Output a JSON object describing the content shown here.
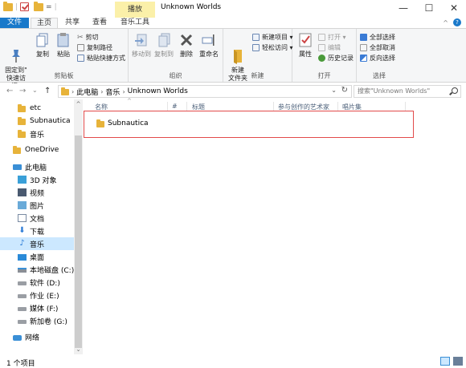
{
  "titlebar": {
    "qat_separator": "|",
    "qat_customize": "=",
    "contextual_tab": "播放",
    "title": "Unknown Worlds",
    "minimize": "—",
    "maximize": "☐",
    "close": "✕"
  },
  "tabs": {
    "file": "文件",
    "home": "主页",
    "share": "共享",
    "view": "查看",
    "music_tools": "音乐工具",
    "collapse": "^",
    "help": "?"
  },
  "ribbon": {
    "clipboard": {
      "pin": "固定到\"\n快速访问\"",
      "copy": "复制",
      "paste": "粘贴",
      "cut": "剪切",
      "copy_path": "复制路径",
      "paste_shortcut": "粘贴快捷方式",
      "label": "剪贴板"
    },
    "organize": {
      "move_to": "移动到",
      "copy_to": "复制到",
      "delete": "删除",
      "rename": "重命名",
      "label": "组织"
    },
    "new": {
      "new_folder": "新建\n文件夹",
      "new_item": "新建项目 ▾",
      "easy_access": "轻松访问 ▾",
      "label": "新建"
    },
    "open": {
      "properties": "属性",
      "open": "打开 ▾",
      "edit": "编辑",
      "history": "历史记录",
      "label": "打开"
    },
    "select": {
      "select_all": "全部选择",
      "select_none": "全部取消",
      "invert": "反向选择",
      "label": "选择"
    }
  },
  "address": {
    "back": "←",
    "forward": "→",
    "recent": "⌄",
    "up": "↑",
    "sep": "›",
    "crumbs": [
      "此电脑",
      "音乐",
      "Unknown Worlds"
    ],
    "dropdown": "⌄",
    "refresh": "↻",
    "search_placeholder": "搜索\"Unknown Worlds\""
  },
  "nav": {
    "items": [
      {
        "label": "etc"
      },
      {
        "label": "Subnautica"
      },
      {
        "label": "音乐"
      },
      {
        "label": "OneDrive"
      },
      {
        "label": "此电脑"
      },
      {
        "label": "3D 对象"
      },
      {
        "label": "视频"
      },
      {
        "label": "图片"
      },
      {
        "label": "文档"
      },
      {
        "label": "下载"
      },
      {
        "label": "音乐"
      },
      {
        "label": "桌面"
      },
      {
        "label": "本地磁盘 (C:)"
      },
      {
        "label": "软件 (D:)"
      },
      {
        "label": "作业 (E:)"
      },
      {
        "label": "媒体 (F:)"
      },
      {
        "label": "新加卷 (G:)"
      },
      {
        "label": "网络"
      }
    ],
    "scroll_up": "^",
    "scroll_down": "⌄"
  },
  "content": {
    "sort_caret": "^",
    "columns": [
      "名称",
      "#",
      "标题",
      "参与创作的艺术家",
      "唱片集"
    ],
    "files": [
      {
        "name": "Subnautica"
      }
    ]
  },
  "status": {
    "count": "1 个项目"
  },
  "colors": {
    "accent": "#1979ca",
    "folder": "#e7b33a",
    "selected_nav": "#cce8ff",
    "highlight_box": "#e24a4a"
  }
}
